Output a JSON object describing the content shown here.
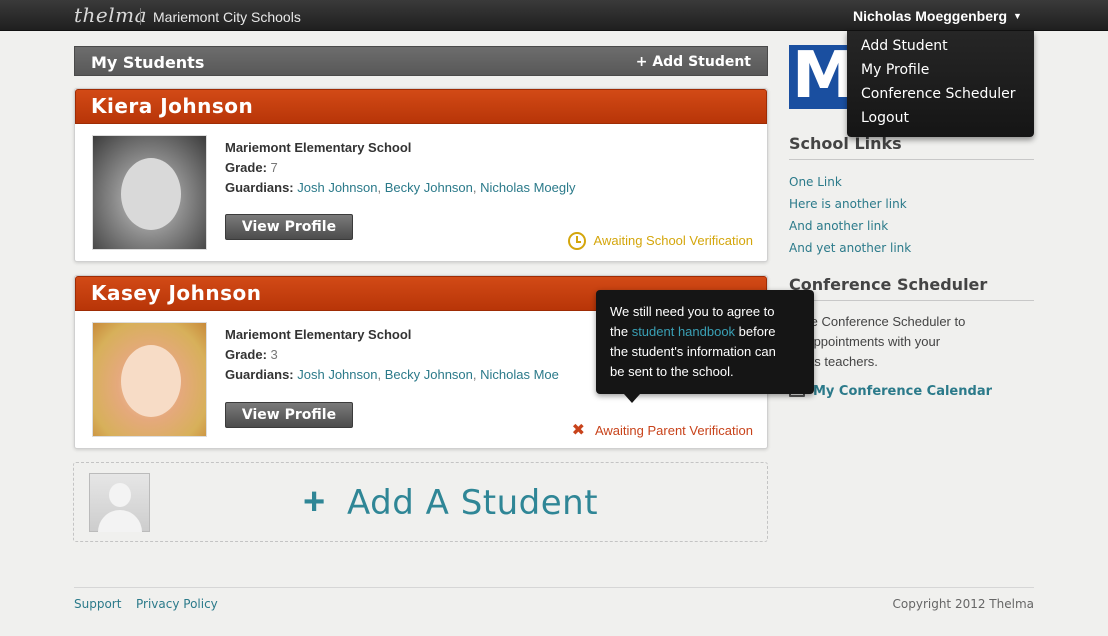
{
  "topbar": {
    "logo": "thelma",
    "district": "Mariemont City Schools",
    "user_name": "Nicholas Moeggenberg",
    "caret": "▼"
  },
  "user_menu": {
    "items": [
      "Add Student",
      "My Profile",
      "Conference Scheduler",
      "Logout"
    ]
  },
  "students_section": {
    "title": "My Students",
    "add_label": "+ Add Student"
  },
  "students": [
    {
      "name": "Kiera Johnson",
      "school": "Mariemont Elementary School",
      "grade_label": "Grade:",
      "grade": "7",
      "guardians_label": "Guardians:",
      "guardians": [
        "Josh Johnson",
        "Becky Johnson",
        "Nicholas Moegly"
      ],
      "view_label": "View Profile",
      "status": "Awaiting School Verification",
      "status_icon": "clock-icon"
    },
    {
      "name": "Kasey Johnson",
      "school": "Mariemont Elementary School",
      "grade_label": "Grade:",
      "grade": "3",
      "guardians_label": "Guardians:",
      "guardians": [
        "Josh Johnson",
        "Becky Johnson",
        "Nicholas Moe"
      ],
      "view_label": "View Profile",
      "status": "Awaiting Parent Verification",
      "status_icon": "x-icon"
    }
  ],
  "tooltip": {
    "line1": "We still need you to agree to",
    "pre_link": "the ",
    "link": "student handbook",
    "post_link": " before",
    "line3": "the student's information can",
    "line4": "be sent to the school."
  },
  "add_student_box": {
    "plus": "+",
    "label": "Add A Student"
  },
  "sidebar": {
    "logo_letter": "M",
    "school_links_title": "School Links",
    "school_links": [
      "One Link",
      "Here is another link",
      "And another link",
      "And yet another link"
    ],
    "conference_title": "Conference Scheduler",
    "conference_text_1": "e the Conference Scheduler to",
    "conference_text_2": "ke appointments with your",
    "conference_text_3": "dents teachers.",
    "calendar_link": "My Conference Calendar"
  },
  "footer": {
    "support": "Support",
    "privacy": "Privacy Policy",
    "copyright": "Copyright 2012 Thelma"
  },
  "colors": {
    "accent_orange": "#c23f0e",
    "link_teal": "#2b7a8a",
    "topbar_dark": "#2a2a2a",
    "school_blue": "#1a4fa0"
  }
}
